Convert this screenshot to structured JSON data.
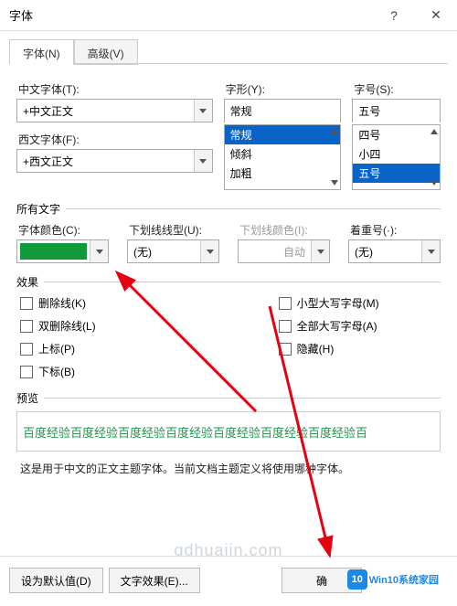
{
  "window": {
    "title": "字体",
    "help": "?",
    "close": "✕"
  },
  "tabs": {
    "font": "字体(N)",
    "advanced": "高级(V)"
  },
  "labels": {
    "cn_font": "中文字体(T):",
    "west_font": "西文字体(F):",
    "style": "字形(Y):",
    "size": "字号(S):",
    "all_text": "所有文字",
    "font_color": "字体颜色(C):",
    "under_style": "下划线线型(U):",
    "under_color": "下划线颜色(I):",
    "emphasis": "着重号(·):",
    "effects": "效果",
    "preview": "预览"
  },
  "values": {
    "cn_font": "+中文正文",
    "west_font": "+西文正文",
    "style_text": "常规",
    "size_text": "五号",
    "style_list": [
      "常规",
      "倾斜",
      "加粗"
    ],
    "size_list": [
      "四号",
      "小四",
      "五号"
    ],
    "under_style": "(无)",
    "under_color": "自动",
    "emphasis": "(无)",
    "font_color_hex": "#109a3a"
  },
  "effects": {
    "strike": "删除线(K)",
    "dstrike": "双删除线(L)",
    "sup": "上标(P)",
    "sub": "下标(B)",
    "smallcaps": "小型大写字母(M)",
    "allcaps": "全部大写字母(A)",
    "hidden": "隐藏(H)"
  },
  "preview": {
    "text": "百度经验百度经验百度经验百度经验百度经验百度经验百度经验百",
    "desc": "这是用于中文的正文主题字体。当前文档主题定义将使用哪种字体。"
  },
  "buttons": {
    "set_default": "设为默认值(D)",
    "text_effect": "文字效果(E)...",
    "ok": "确",
    "cancel": ""
  },
  "watermark": "qdhuajin.com",
  "logo": {
    "brand": "10",
    "text": "Win10系统家园"
  }
}
